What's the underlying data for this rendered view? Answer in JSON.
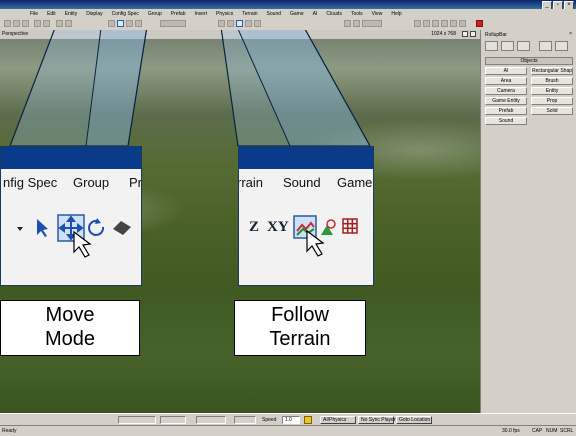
{
  "menu": [
    "File",
    "Edit",
    "Entity",
    "Display",
    "Config Spec",
    "Group",
    "Prefab",
    "Insert",
    "Physics",
    "Terrain",
    "Sound",
    "Game",
    "AI",
    "Clouds",
    "Tools",
    "View",
    "Help"
  ],
  "viewport": {
    "label": "Perspective",
    "coords": "1024 x 768"
  },
  "zoom_left": {
    "menu": [
      "nfig Spec",
      "Group",
      "Pr"
    ],
    "caption": [
      "Move",
      "Mode"
    ]
  },
  "zoom_right": {
    "menu": [
      "rrain",
      "Sound",
      "Game"
    ],
    "icons": [
      "Z",
      "XY"
    ],
    "caption": [
      "Follow",
      "Terrain"
    ]
  },
  "rollup": {
    "title": "RollupBar",
    "close": "×",
    "objects_header": "Objects"
  },
  "objects": [
    "AI",
    "Rectangular Shape",
    "Area",
    "Brush",
    "Camera",
    "Entity",
    "Game Entity",
    "Prop",
    "Prefab",
    "Solid",
    "Sound"
  ],
  "status": {
    "speed_label": "Speed",
    "speed_value": "1.0",
    "buttons": [
      "AI/Physics",
      "No Sync Player",
      "Goto Location"
    ],
    "ready": "Ready",
    "fps": "30.0 fps",
    "cap": "CAP",
    "num": "NUM",
    "scrl": "SCRL"
  }
}
